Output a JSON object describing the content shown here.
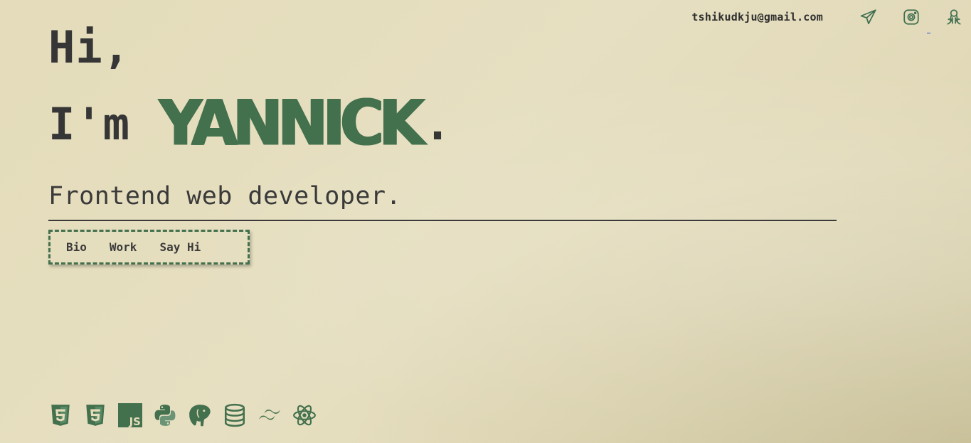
{
  "contact": {
    "email": "tshikudkju@gmail.com",
    "icons": [
      "telegram-icon",
      "instagram-icon",
      "github-icon"
    ]
  },
  "hero": {
    "greeting": "Hi,",
    "intro_prefix": "I'm",
    "name": "YANNICK",
    "name_suffix": ".",
    "role": "Frontend web developer."
  },
  "nav": {
    "items": [
      "Bio",
      "Work",
      "Say Hi"
    ]
  },
  "stack": {
    "icons": [
      "html5-icon",
      "css3-icon",
      "javascript-icon",
      "python-icon",
      "postgresql-icon",
      "database-icon",
      "tailwind-icon",
      "react-icon"
    ]
  },
  "colors": {
    "accent": "#43704d",
    "text": "#363636",
    "background": "#e4dcba"
  }
}
